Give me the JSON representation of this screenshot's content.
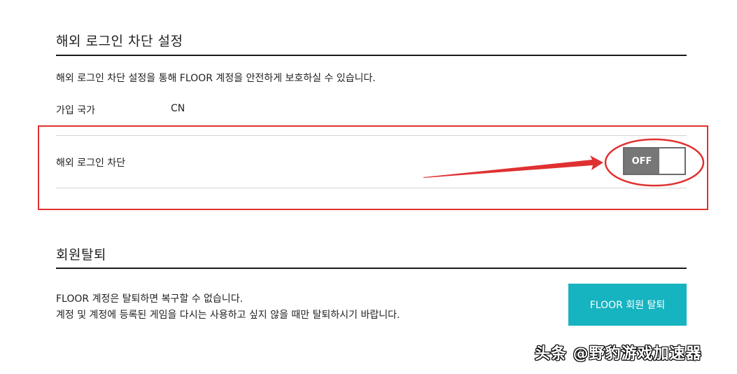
{
  "overseas_block": {
    "title": "해외 로그인 차단 설정",
    "description": "해외 로그인 차단 설정을 통해 FLOOR 계정을 안전하게 보호하실 수 있습니다.",
    "country_label": "가입 국가",
    "country_value": "CN",
    "block_label": "해외 로그인 차단",
    "toggle_state": "OFF"
  },
  "withdraw": {
    "title": "회원탈퇴",
    "line1": "FLOOR 계정은 탈퇴하면 복구할 수 없습니다.",
    "line2": "계정 및 계정에 등록된 게임을 다시는 사용하고 싶지 않을 때만 탈퇴하시기 바랍니다.",
    "button_label": "FLOOR 회원 탈퇴"
  },
  "watermark": "头条 @野豹游戏加速器",
  "colors": {
    "accent": "#16b3c0",
    "annotation": "#e03131",
    "toggle_off_bg": "#777777"
  }
}
